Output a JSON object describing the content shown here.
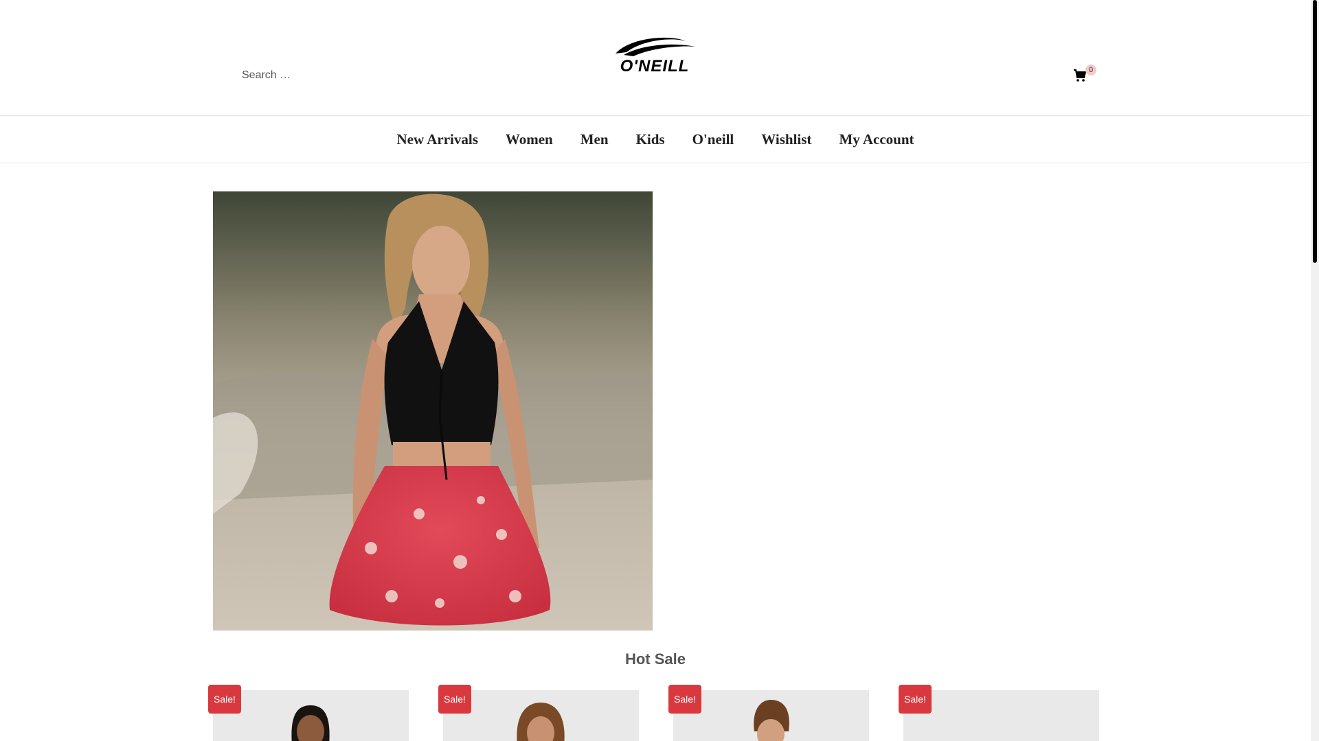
{
  "header": {
    "search_placeholder": "Search …",
    "logo_text": "O'NEILL",
    "cart_count": "0"
  },
  "nav": {
    "items": [
      "New Arrivals",
      "Women",
      "Men",
      "Kids",
      "O'neill",
      "Wishlist",
      "My Account"
    ]
  },
  "main": {
    "section_title": "Hot Sale",
    "products": [
      {
        "badge": "Sale!"
      },
      {
        "badge": "Sale!"
      },
      {
        "badge": "Sale!"
      },
      {
        "badge": "Sale!"
      }
    ]
  },
  "colors": {
    "sale_badge": "#d9393e",
    "cart_badge": "#f3c9c9"
  },
  "icons": {
    "cart": "cart-icon",
    "logo_wave": "wave-logo-icon"
  }
}
